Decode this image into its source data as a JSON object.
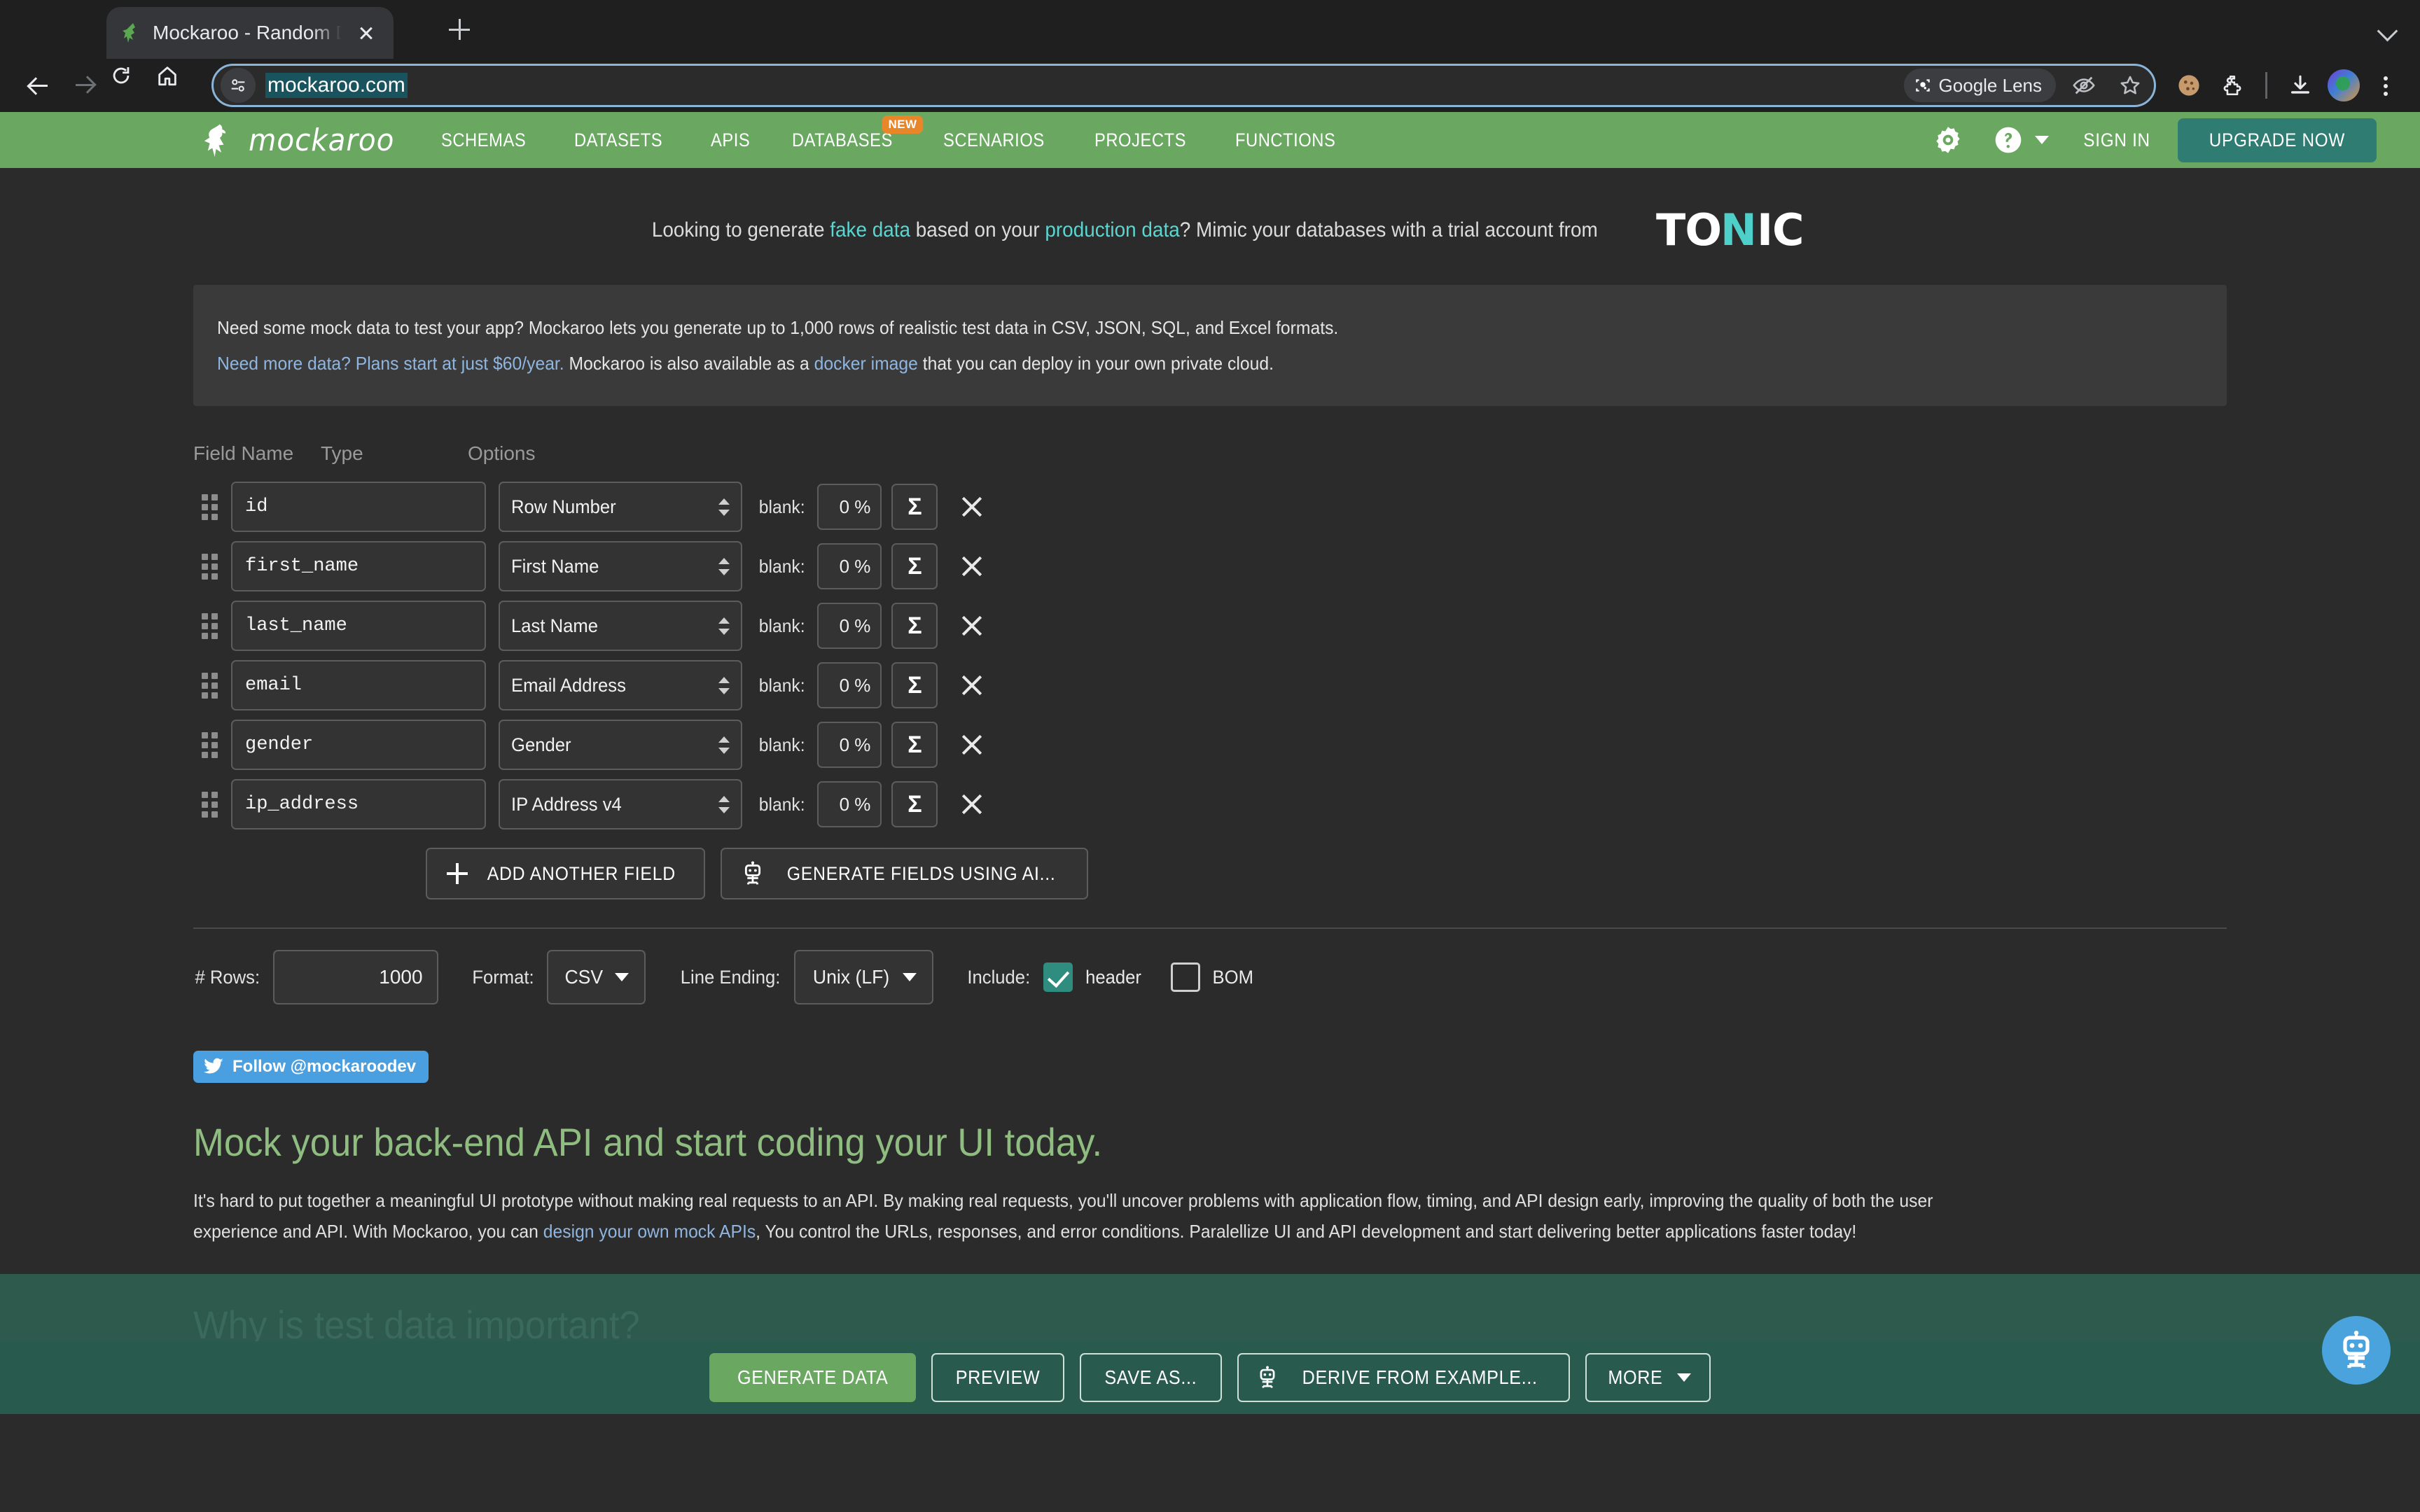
{
  "browser": {
    "tab_title": "Mockaroo - Random Data Ge",
    "url": "mockaroo.com",
    "lens_label": "Google Lens",
    "icons": {
      "back": "back-arrow-icon",
      "forward": "forward-arrow-icon",
      "reload": "reload-icon",
      "home": "home-icon",
      "site_info": "site-settings-icon",
      "incognito_eye": "eye-off-icon",
      "bookmark": "star-icon",
      "cookie": "cookie-extension-icon",
      "extensions": "extensions-puzzle-icon",
      "downloads": "download-icon",
      "profile": "profile-avatar",
      "menu": "kebab-menu-icon"
    }
  },
  "site_nav": {
    "brand": "mockaroo",
    "items": [
      {
        "label": "SCHEMAS",
        "badge": null
      },
      {
        "label": "DATASETS",
        "badge": null
      },
      {
        "label": "APIS",
        "badge": null
      },
      {
        "label": "DATABASES",
        "badge": "NEW"
      },
      {
        "label": "SCENARIOS",
        "badge": null
      },
      {
        "label": "PROJECTS",
        "badge": null
      },
      {
        "label": "FUNCTIONS",
        "badge": null
      }
    ],
    "sign_in": "SIGN IN",
    "upgrade": "UPGRADE NOW",
    "gear_icon": "gear-icon",
    "help_icon": "help-circle-icon"
  },
  "promo": {
    "p1": "Looking to generate ",
    "link1": "fake data",
    "p2": " based on your ",
    "link2": "production data",
    "p3": "? Mimic your databases with a trial account from",
    "logo_a": "TO",
    "logo_b": "И",
    "logo_c": "IC"
  },
  "infobox": {
    "line1": "Need some mock data to test your app? Mockaroo lets you generate up to 1,000 rows of realistic test data in CSV, JSON, SQL, and Excel formats.",
    "line2_link1": "Need more data? Plans start at just $60/year.",
    "line2_mid": " Mockaroo is also available as a ",
    "line2_link2": "docker image",
    "line2_end": " that you can deploy in your own private cloud."
  },
  "schema": {
    "headers": {
      "field_name": "Field Name",
      "type": "Type",
      "options": "Options"
    },
    "blank_label": "blank:",
    "sigma_glyph": "Σ",
    "rows": [
      {
        "name": "id",
        "type": "Row Number",
        "blank": "0 %"
      },
      {
        "name": "first_name",
        "type": "First Name",
        "blank": "0 %"
      },
      {
        "name": "last_name",
        "type": "Last Name",
        "blank": "0 %"
      },
      {
        "name": "email",
        "type": "Email Address",
        "blank": "0 %"
      },
      {
        "name": "gender",
        "type": "Gender",
        "blank": "0 %"
      },
      {
        "name": "ip_address",
        "type": "IP Address v4",
        "blank": "0 %"
      }
    ],
    "add_field": "ADD ANOTHER FIELD",
    "generate_ai": "GENERATE FIELDS USING AI..."
  },
  "options": {
    "rows_label": "# Rows:",
    "rows_value": "1000",
    "format_label": "Format:",
    "format_value": "CSV",
    "line_ending_label": "Line Ending:",
    "line_ending_value": "Unix (LF)",
    "include_label": "Include:",
    "header_label": "header",
    "header_checked": true,
    "bom_label": "BOM",
    "bom_checked": false
  },
  "twitter": {
    "label": "Follow @mockaroodev"
  },
  "article": {
    "heading": "Mock your back-end API and start coding your UI today.",
    "p_line1_a": "It's hard to put together a meaningful UI prototype without making real requests to an API. By making real requests, you'll uncover problems with application flow, timing, and API design early, improving the quality of both the user",
    "p_line2_a": "experience and API. With Mockaroo, you can ",
    "p_line2_link": "design your own mock APIs",
    "p_line2_b": ", You control the URLs, responses, and error conditions. Paralellize UI and API development and start delivering better applications faster today!",
    "heading2": "Why is test data important?"
  },
  "bottombar": {
    "buttons": [
      {
        "label": "GENERATE DATA",
        "primary": true,
        "icon": null
      },
      {
        "label": "PREVIEW",
        "primary": false,
        "icon": null
      },
      {
        "label": "SAVE AS...",
        "primary": false,
        "icon": null
      },
      {
        "label": "DERIVE FROM EXAMPLE...",
        "primary": false,
        "icon": "robot-icon"
      },
      {
        "label": "MORE",
        "primary": false,
        "icon": "caret-down-icon"
      }
    ],
    "fab_icon": "robot-chat-icon"
  },
  "colors": {
    "nav_green": "#6aa862",
    "upgrade_teal": "#2f7c72",
    "accent_teal": "#5ad6d0",
    "link_blue": "#8fb6e0",
    "badge_orange": "#e8862a",
    "heading_green": "#8fbd80",
    "footer_green": "#2d5a4d",
    "twitter_blue": "#4a9fe0",
    "fab_blue": "#4aa3dd"
  }
}
